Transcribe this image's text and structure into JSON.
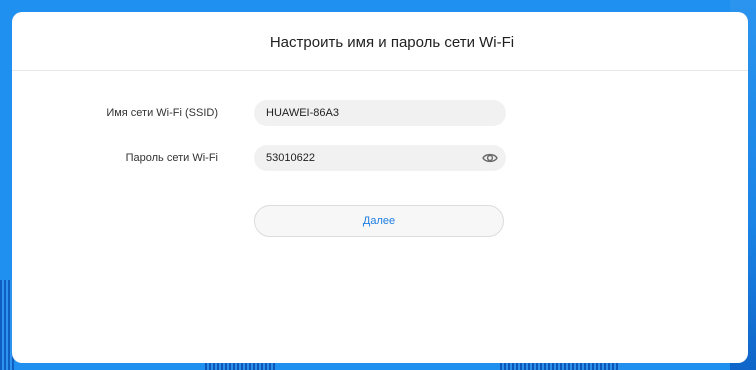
{
  "dialog": {
    "title": "Настроить имя и пароль сети Wi-Fi"
  },
  "form": {
    "ssid_label": "Имя сети Wi-Fi (SSID)",
    "ssid_value": "HUAWEI-86A3",
    "password_label": "Пароль сети Wi-Fi",
    "password_value": "53010622",
    "toggle_icon": "eye-icon"
  },
  "actions": {
    "next_label": "Далее"
  },
  "colors": {
    "background": "#1f8ff0",
    "card": "#ffffff",
    "input_bg": "#f1f1f1",
    "accent": "#1f7fe0"
  }
}
